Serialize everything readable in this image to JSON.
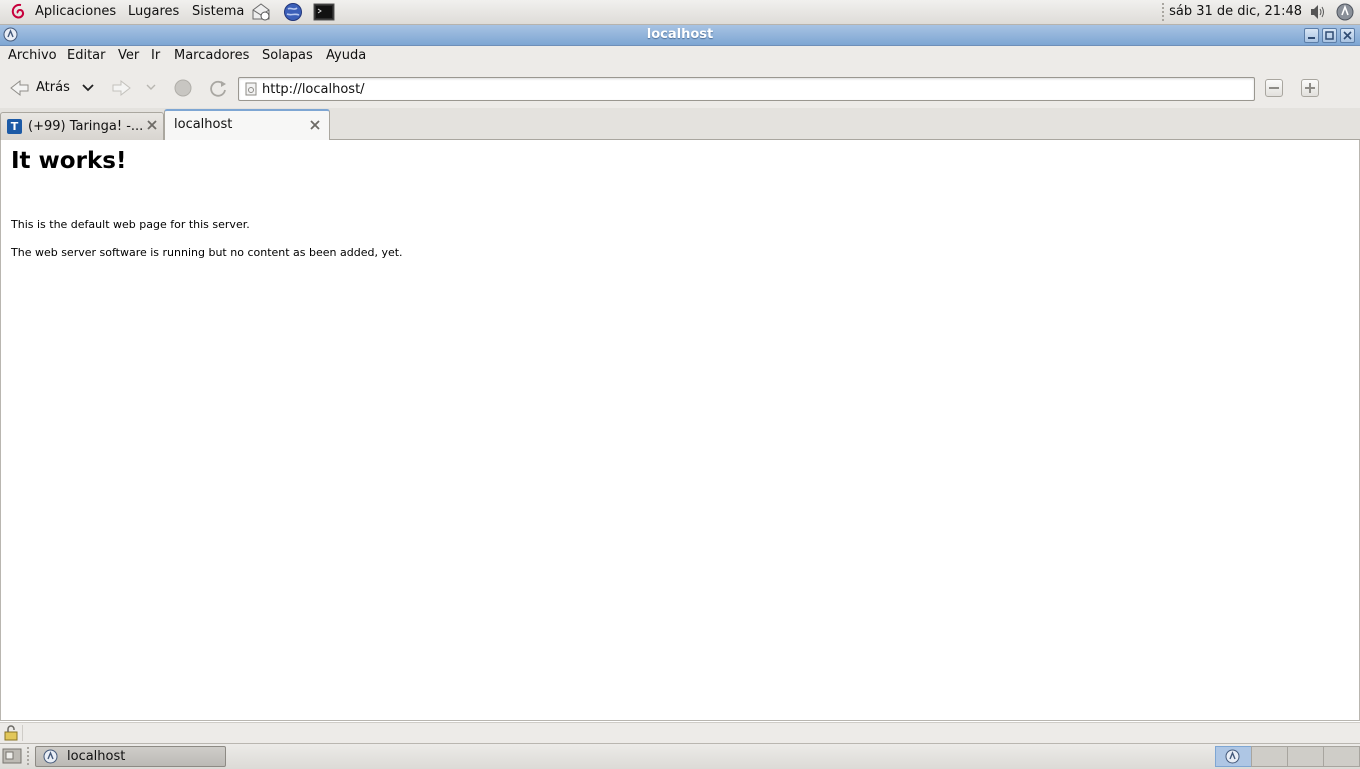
{
  "top_panel": {
    "menus": [
      "Aplicaciones",
      "Lugares",
      "Sistema"
    ],
    "launchers": [
      "mail-icon",
      "web-browser-icon",
      "terminal-icon"
    ],
    "clock": "sáb 31 de dic, 21:48",
    "tray": [
      "volume-icon",
      "network-icon"
    ]
  },
  "window": {
    "title": "localhost",
    "controls": [
      "minimize-icon",
      "maximize-icon",
      "close-icon"
    ]
  },
  "menubar": {
    "items": [
      "Archivo",
      "Editar",
      "Ver",
      "Ir",
      "Marcadores",
      "Solapas",
      "Ayuda"
    ]
  },
  "navbar": {
    "back_label": "Atrás",
    "url": "http://localhost/"
  },
  "tabs": [
    {
      "label": "(+99) Taringa! -...",
      "favicon": "T",
      "active": false
    },
    {
      "label": "localhost",
      "active": true
    }
  ],
  "page": {
    "heading": "It works!",
    "paragraphs": [
      "This is the default web page for this server.",
      "The web server software is running but no content as been added, yet."
    ]
  },
  "bottom_panel": {
    "task_label": "localhost"
  },
  "colors": {
    "titlebar": "#7ea6d3",
    "panel": "#dedcd8",
    "toolbar": "#edebe8"
  }
}
